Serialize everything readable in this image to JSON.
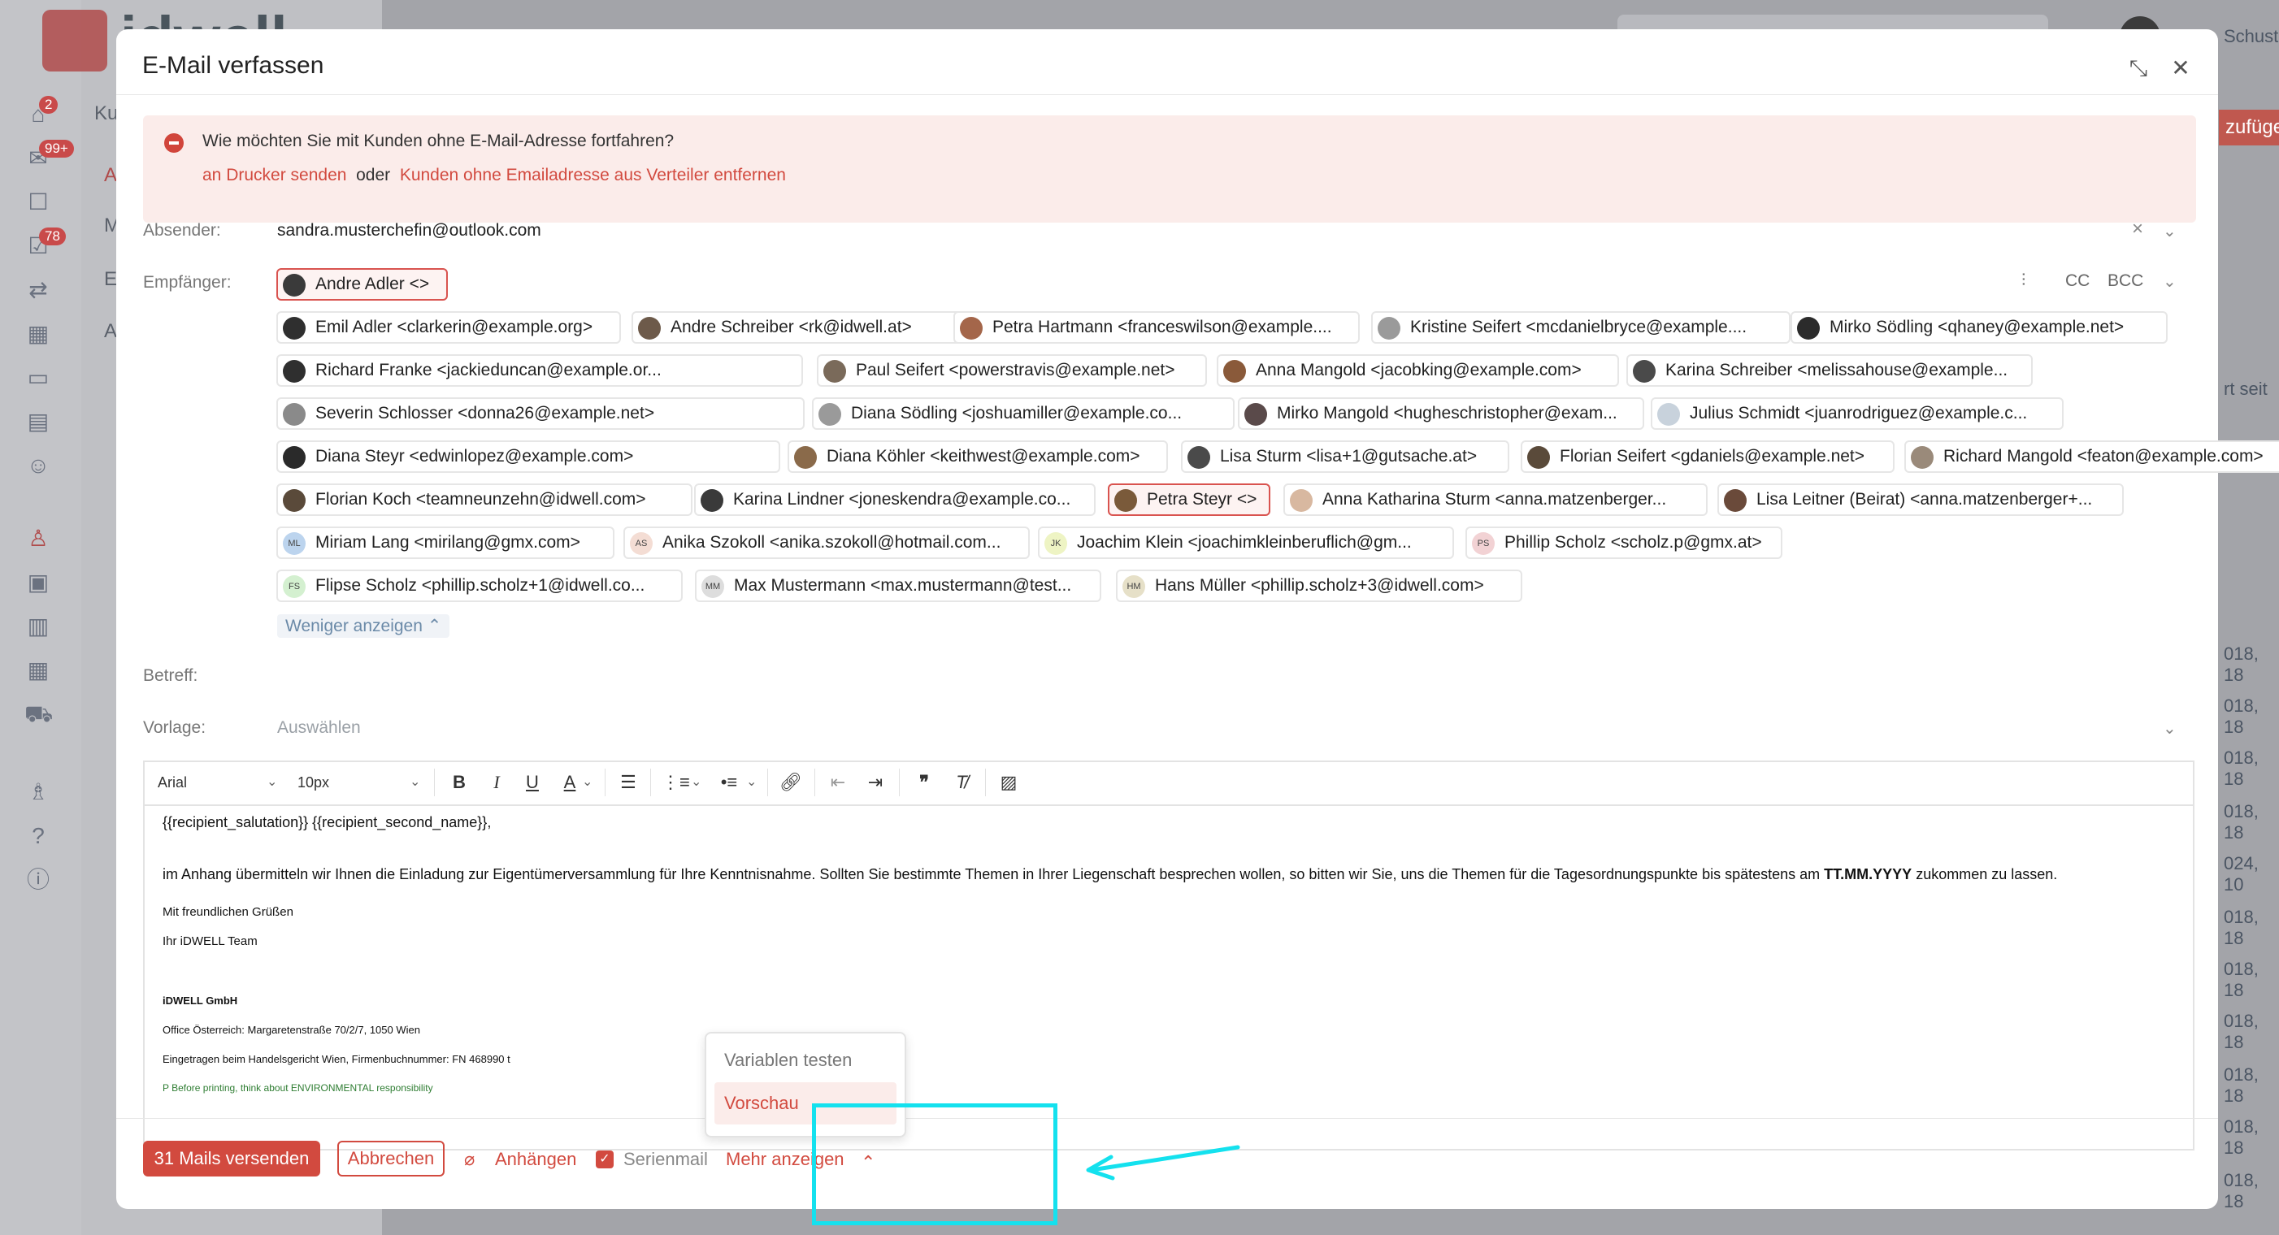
{
  "background": {
    "logo_text": "idwell",
    "badges": [
      "2",
      "99+",
      "78"
    ],
    "user_name": "Schuste",
    "add_button": "zufügen",
    "right_texts": [
      "rt seit",
      "018, 18",
      "018, 18",
      "018, 18",
      "018, 18",
      "024, 10",
      "018, 18",
      "018, 18",
      "018, 18",
      "018, 18",
      "018, 18",
      "018, 18"
    ],
    "sidebar_letters": [
      "Ku",
      "A",
      "M",
      "E",
      "A"
    ]
  },
  "modal": {
    "title": "E-Mail verfassen",
    "alert": {
      "question": "Wie möchten Sie mit Kunden ohne E-Mail-Adresse fortfahren?",
      "link_print": "an Drucker senden",
      "or": "oder",
      "link_remove": "Kunden ohne Emailadresse aus Verteiler entfernen"
    },
    "sender": {
      "label": "Absender:",
      "value": "sandra.musterchefin@outlook.com"
    },
    "recipients": {
      "label": "Empfänger:",
      "cc": "CC",
      "bcc": "BCC",
      "show_less": "Weniger anzeigen",
      "chips": [
        "Andre Adler <>",
        "Emil Adler <clarkerin@example.org>",
        "Andre Schreiber <rk@idwell.at>",
        "Petra Hartmann <franceswilson@example....",
        "Kristine Seifert <mcdanielbryce@example....",
        "Mirko Södling <qhaney@example.net>",
        "Richard Franke <jackieduncan@example.or...",
        "Paul Seifert <powerstravis@example.net>",
        "Anna Mangold <jacobking@example.com>",
        "Karina Schreiber <melissahouse@example...",
        "Severin Schlosser <donna26@example.net>",
        "Diana Södling <joshuamiller@example.co...",
        "Mirko Mangold <hugheschristopher@exam...",
        "Julius Schmidt <juanrodriguez@example.c...",
        "Diana Steyr <edwinlopez@example.com>",
        "Diana Köhler <keithwest@example.com>",
        "Lisa Sturm <lisa+1@gutsache.at>",
        "Florian Seifert <gdaniels@example.net>",
        "Richard Mangold <featon@example.com>",
        "Florian Koch <teamneunzehn@idwell.com>",
        "Karina Lindner <joneskendra@example.co...",
        "Petra Steyr <>",
        "Anna Katharina Sturm <anna.matzenberger...",
        "Lisa Leitner (Beirat) <anna.matzenberger+...",
        "Miriam Lang <mirilang@gmx.com>",
        "Anika Szokoll <anika.szokoll@hotmail.com...",
        "Joachim Klein <joachimkleinberuflich@gm...",
        "Phillip Scholz <scholz.p@gmx.at>",
        "Flipse Scholz <phillip.scholz+1@idwell.co...",
        "Max Mustermann <max.mustermann@test...",
        "Hans Müller <phillip.scholz+3@idwell.com>"
      ],
      "initials": [
        "ML",
        "AS",
        "JK",
        "PS",
        "FS",
        "MM",
        "HM"
      ]
    },
    "subject": {
      "label": "Betreff:"
    },
    "template": {
      "label": "Vorlage:",
      "placeholder": "Auswählen"
    },
    "editor": {
      "font": "Arial",
      "size": "10px",
      "lines": {
        "salutation": "{{recipient_salutation}} {{recipient_second_name}},",
        "body_pre": "im Anhang übermitteln wir Ihnen die Einladung zur Eigentümerversammlung für Ihre Kenntnisnahme. Sollten Sie bestimmte Themen in Ihrer Liegenschaft besprechen wollen, so bitten wir Sie, uns die Themen für die Tagesordnungspunkte bis spätestens am",
        "body_bold": "TT.MM.YYYY",
        "body_post": "zukommen zu lassen.",
        "greeting": "Mit freundlichen Grüßen",
        "team": "Ihr iDWELL Team",
        "company": "iDWELL GmbH",
        "office": "Office Österreich: Margaretenstraße 70/2/7, 1050 Wien",
        "register": "Eingetragen beim Handelsgericht Wien, Firmenbuchnummer: FN 468990 t",
        "eco": "P Before printing, think about ENVIRONMENTAL responsibility"
      }
    },
    "footer": {
      "send": "31 Mails versenden",
      "cancel": "Abbrechen",
      "attach": "Anhängen",
      "serial": "Serienmail",
      "more": "Mehr anzeigen"
    },
    "dropdown": {
      "item1": "Variablen testen",
      "item2": "Vorschau"
    }
  },
  "colors": {
    "accent": "#d24a3f",
    "highlight": "#14e1ee",
    "alert_bg": "#fbecea"
  }
}
